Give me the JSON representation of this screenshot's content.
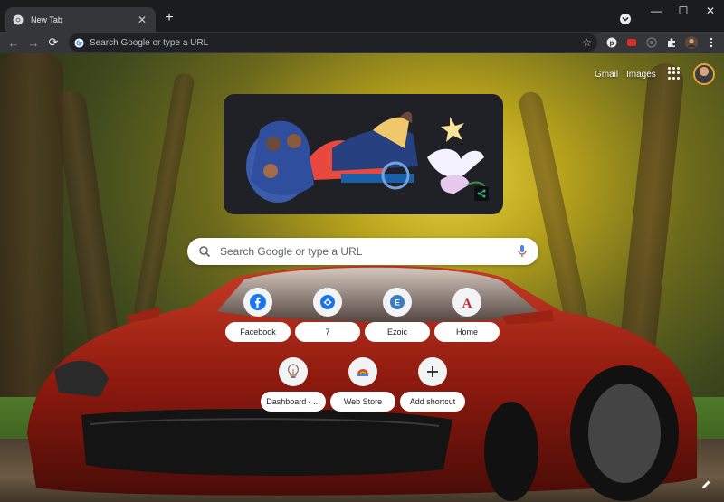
{
  "browser": {
    "tab": {
      "title": "New Tab",
      "close": "✕"
    },
    "new_tab": "+",
    "window_controls": {
      "minimize": "—",
      "maximize": "☐",
      "close": "✕"
    }
  },
  "toolbar": {
    "back": "←",
    "forward": "→",
    "reload": "⟳",
    "omnibox_placeholder": "Search Google or type a URL",
    "bookmark_star": "☆"
  },
  "ntp": {
    "header_links": {
      "gmail": "Gmail",
      "images": "Images"
    },
    "search": {
      "placeholder": "Search Google or type a URL"
    },
    "shortcuts": [
      {
        "label": "Facebook",
        "icon": "facebook-icon",
        "color": "#1877f2"
      },
      {
        "label": "7",
        "icon": "weather-icon",
        "color": "#1a73e8"
      },
      {
        "label": "Ezoic",
        "icon": "ezoic-icon",
        "color": "#3b7bbf"
      },
      {
        "label": "Home",
        "icon": "home-logo-icon",
        "color": "#c62828"
      },
      {
        "label": "Dashboard ‹ ...",
        "icon": "lightbulb-icon",
        "color": "#8d6e63"
      },
      {
        "label": "Web Store",
        "icon": "web-store-icon",
        "color": "#4285f4"
      },
      {
        "label": "Add shortcut",
        "icon": "plus-icon",
        "color": "#202124"
      }
    ]
  },
  "colors": {
    "tab_strip": "#1b1c1e",
    "toolbar": "#35363a",
    "omnibox": "#202124",
    "car_red": "#a31c12"
  }
}
